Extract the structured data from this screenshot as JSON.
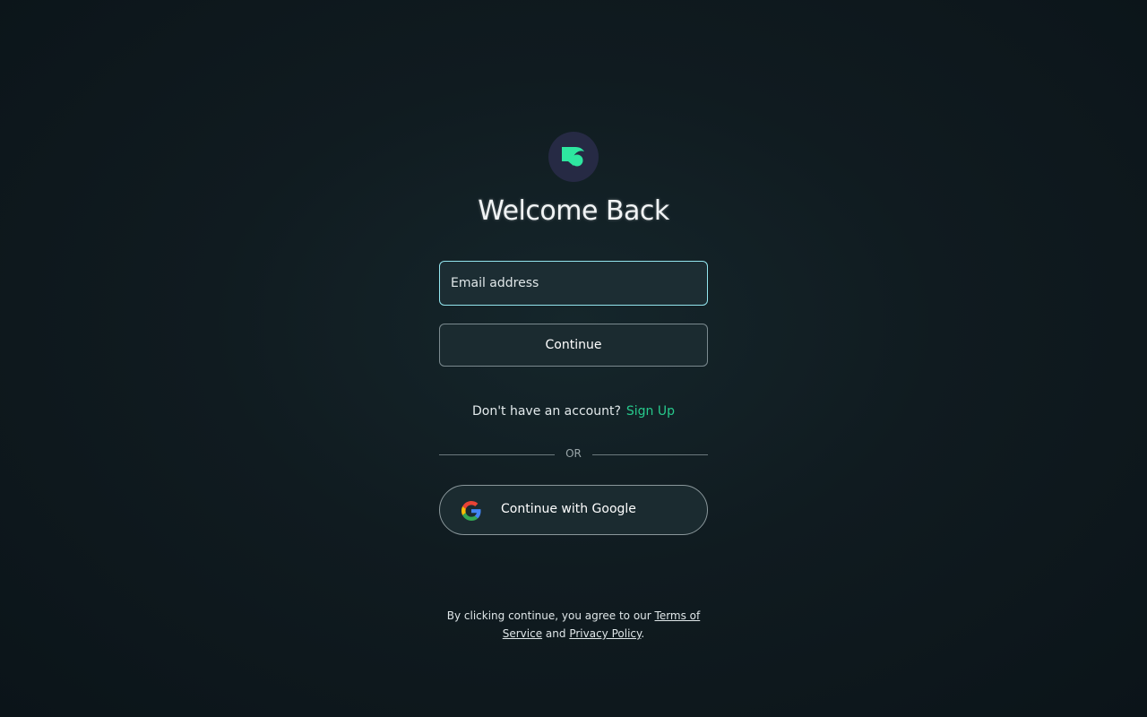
{
  "brand": {
    "logo_icon": "brand-logo-icon",
    "logo_bg": "#262a44",
    "accent": "#2ee6a0"
  },
  "heading": "Welcome Back",
  "email": {
    "placeholder": "Email address",
    "value": ""
  },
  "continue_label": "Continue",
  "signup": {
    "question": "Don't have an account?",
    "link_label": "Sign Up",
    "link_color": "#27c98c"
  },
  "divider_label": "OR",
  "google": {
    "icon": "google-icon",
    "label": "Continue with Google"
  },
  "legal": {
    "prefix": "By clicking continue, you agree to our ",
    "terms_label": "Terms of Service",
    "and_text": " and ",
    "privacy_label": "Privacy Policy",
    "suffix": "."
  }
}
